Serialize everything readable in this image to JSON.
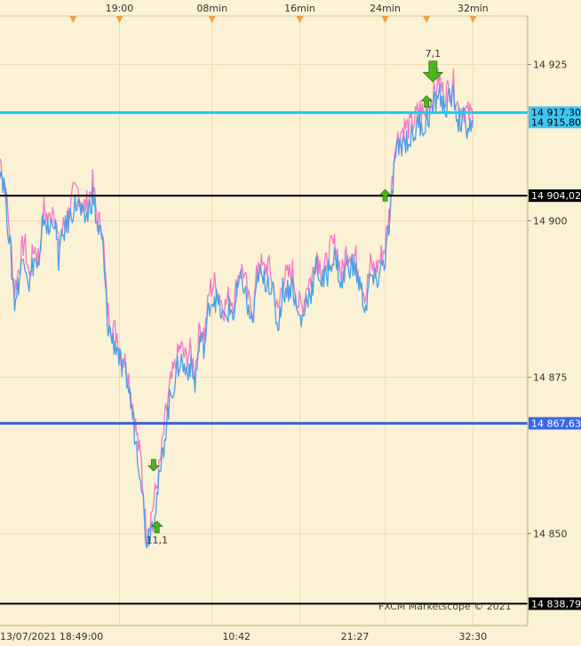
{
  "chart_data": {
    "type": "line",
    "watermark": "FXCM Marketscope © 2021",
    "ylim": [
      14836,
      14935
    ],
    "xlim": [
      0,
      100
    ],
    "grid": true,
    "y_ticks": [
      {
        "label": "14 925",
        "value": 14925
      },
      {
        "label": "14 900",
        "value": 14900
      },
      {
        "label": "14 875",
        "value": 14875
      },
      {
        "label": "14 850",
        "value": 14850
      }
    ],
    "x_top_ticks": [
      {
        "label": "19:00",
        "x": 24.5
      },
      {
        "label": "08min",
        "x": 43.5
      },
      {
        "label": "16min",
        "x": 61.5
      },
      {
        "label": "24min",
        "x": 79.0
      },
      {
        "label": "32min",
        "x": 97.0
      }
    ],
    "x_bottom_ticks": [
      {
        "label": "13/07/2021 18:49:00",
        "x": 0
      },
      {
        "label": "10:42",
        "x": 48.5
      },
      {
        "label": "21:27",
        "x": 72.8
      },
      {
        "label": "32:30",
        "x": 97.0
      }
    ],
    "top_markers_x": [
      15,
      24.5,
      43.5,
      61.5,
      79,
      87.5,
      97
    ],
    "grid_x": [
      24.5,
      43.5,
      61.5,
      79.0,
      97.0
    ],
    "level_lines": [
      {
        "value": 14917.3,
        "label": "14 917,30",
        "color": "#1ec8f0",
        "tagbg": "#41c6f0",
        "tagfg": "#000000",
        "width": 3
      },
      {
        "value": 14915.8,
        "label": "14 915,80",
        "color": "#1ec8f0",
        "tagbg": "#41c6f0",
        "tagfg": "#000000",
        "width": 0
      },
      {
        "value": 14904.02,
        "label": "14 904,02",
        "color": "#000000",
        "tagbg": "#000000",
        "tagfg": "#ffffff",
        "width": 2
      },
      {
        "value": 14867.63,
        "label": "14 867,63",
        "color": "#3a5fe0",
        "tagbg": "#3a67e8",
        "tagfg": "#ffffff",
        "width": 3
      },
      {
        "value": 14838.79,
        "label": "14 838,79",
        "color": "#000000",
        "tagbg": "#000000",
        "tagfg": "#ffffff",
        "width": 2
      }
    ],
    "series": [
      {
        "color": "#f07ac8",
        "x": [
          0,
          1,
          2,
          3,
          4,
          5,
          6,
          7,
          8,
          9,
          10,
          11,
          12,
          13,
          14,
          15,
          16,
          17,
          18,
          19,
          20,
          21,
          22,
          23,
          24,
          25,
          26,
          27,
          28,
          29,
          30,
          31,
          32,
          33,
          34,
          35,
          36,
          37,
          38,
          39,
          40,
          41,
          42,
          43,
          44,
          45,
          46,
          47,
          48,
          49,
          50,
          51,
          52,
          53,
          54,
          55,
          56,
          57,
          58,
          59,
          60,
          61,
          62,
          63,
          64,
          65,
          66,
          67,
          68,
          69,
          70,
          71,
          72,
          73,
          74,
          75,
          76,
          77,
          78,
          79,
          80,
          81,
          82,
          83,
          84,
          85,
          86,
          87,
          88,
          89,
          90,
          91,
          92,
          93,
          94,
          95,
          96,
          97
        ],
        "values": [
          14910,
          14906,
          14898,
          14889,
          14893,
          14897,
          14891,
          14896,
          14894,
          14902,
          14900,
          14903,
          14896,
          14899,
          14901,
          14904,
          14905,
          14902,
          14903,
          14906,
          14900,
          14899,
          14886,
          14883,
          14882,
          14878,
          14877,
          14872,
          14866,
          14861,
          14850,
          14853,
          14857,
          14862,
          14869,
          14874,
          14877,
          14880,
          14878,
          14879,
          14876,
          14883,
          14882,
          14889,
          14890,
          14888,
          14886,
          14888,
          14887,
          14892,
          14892,
          14887,
          14886,
          14894,
          14892,
          14893,
          14890,
          14885,
          14891,
          14891,
          14892,
          14887,
          14886,
          14890,
          14891,
          14895,
          14892,
          14893,
          14896,
          14896,
          14891,
          14895,
          14895,
          14894,
          14891,
          14888,
          14893,
          14892,
          14894,
          14896,
          14902,
          14912,
          14914,
          14915,
          14915,
          14916,
          14918,
          14917,
          14919,
          14920,
          14923,
          14920,
          14921,
          14922,
          14918,
          14918,
          14917,
          14917
        ],
        "name": ""
      },
      {
        "color": "#4a9fe8",
        "x": [
          0,
          1,
          2,
          3,
          4,
          5,
          6,
          7,
          8,
          9,
          10,
          11,
          12,
          13,
          14,
          15,
          16,
          17,
          18,
          19,
          20,
          21,
          22,
          23,
          24,
          25,
          26,
          27,
          28,
          29,
          30,
          31,
          32,
          33,
          34,
          35,
          36,
          37,
          38,
          39,
          40,
          41,
          42,
          43,
          44,
          45,
          46,
          47,
          48,
          49,
          50,
          51,
          52,
          53,
          54,
          55,
          56,
          57,
          58,
          59,
          60,
          61,
          62,
          63,
          64,
          65,
          66,
          67,
          68,
          69,
          70,
          71,
          72,
          73,
          74,
          75,
          76,
          77,
          78,
          79,
          80,
          81,
          82,
          83,
          84,
          85,
          86,
          87,
          88,
          89,
          90,
          91,
          92,
          93,
          94,
          95,
          96,
          97
        ],
        "values": [
          14909,
          14905,
          14896,
          14887,
          14891,
          14895,
          14890,
          14894,
          14892,
          14901,
          14898,
          14901,
          14894,
          14898,
          14900,
          14902,
          14903,
          14900,
          14901,
          14904,
          14899,
          14897,
          14884,
          14881,
          14880,
          14876,
          14875,
          14870,
          14864,
          14859,
          14849,
          14851,
          14855,
          14860,
          14867,
          14872,
          14875,
          14878,
          14876,
          14877,
          14874,
          14881,
          14880,
          14887,
          14888,
          14886,
          14884,
          14886,
          14885,
          14890,
          14890,
          14885,
          14884,
          14892,
          14890,
          14891,
          14888,
          14883,
          14889,
          14889,
          14890,
          14885,
          14884,
          14888,
          14889,
          14893,
          14890,
          14891,
          14894,
          14894,
          14889,
          14893,
          14893,
          14892,
          14889,
          14886,
          14891,
          14890,
          14892,
          14894,
          14900,
          14910,
          14912,
          14913,
          14913,
          14914,
          14916,
          14915,
          14917,
          14918,
          14921,
          14918,
          14919,
          14920,
          14916,
          14916,
          14915,
          14915
        ],
        "name": ""
      }
    ],
    "signals": [
      {
        "x": 31.5,
        "value": 14861,
        "dir": "down",
        "size": "small",
        "label": ""
      },
      {
        "x": 32.2,
        "value": 14851,
        "dir": "up",
        "size": "small",
        "label": "11,1"
      },
      {
        "x": 79.0,
        "value": 14904,
        "dir": "up",
        "size": "small",
        "label": ""
      },
      {
        "x": 87.5,
        "value": 14919,
        "dir": "up",
        "size": "small",
        "label": ""
      },
      {
        "x": 88.8,
        "value": 14924,
        "dir": "down",
        "size": "large",
        "label": "7,1"
      }
    ]
  }
}
